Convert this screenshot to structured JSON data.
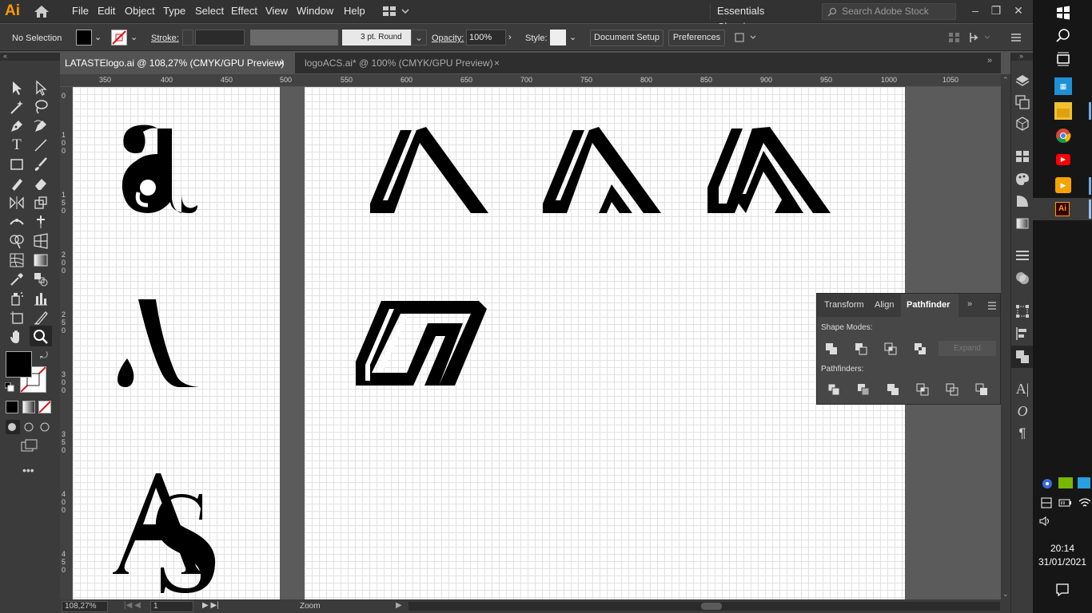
{
  "menu": {
    "app_logo": "Ai",
    "items": [
      "File",
      "Edit",
      "Object",
      "Type",
      "Select",
      "Effect",
      "View",
      "Window",
      "Help"
    ],
    "workspace": "Essentials Classic",
    "search_placeholder": "Search Adobe Stock",
    "win_min": "–",
    "win_max": "❐",
    "win_close": "✕"
  },
  "control": {
    "selection": "No Selection",
    "stroke_label": "Stroke:",
    "brush": "3 pt. Round",
    "opacity_label": "Opacity:",
    "opacity_value": "100%",
    "style_label": "Style:",
    "doc_setup": "Document Setup",
    "preferences": "Preferences"
  },
  "tabs": [
    {
      "label": "LATASTElogo.ai @ 108,27% (CMYK/GPU Preview)",
      "close": "×"
    },
    {
      "label": "logoACS.ai* @ 100% (CMYK/GPU Preview)",
      "close": "×"
    }
  ],
  "ruler": {
    "h": [
      "350",
      "400",
      "450",
      "500",
      "550",
      "600",
      "650",
      "700",
      "750",
      "800",
      "850",
      "900",
      "950",
      "1000",
      "1050"
    ],
    "v": [
      "0",
      "100",
      "150",
      "200",
      "250",
      "300",
      "350",
      "400",
      "450"
    ]
  },
  "status": {
    "zoom": "108,27%",
    "page": "1",
    "tool": "Zoom"
  },
  "pathfinder": {
    "tabs": [
      "Transform",
      "Align",
      "Pathfinder"
    ],
    "shape_modes": "Shape Modes:",
    "pathfinders": "Pathfinders:",
    "expand": "Expand"
  },
  "taskbar": {
    "time": "20:14",
    "date": "31/01/2021"
  },
  "colors": {
    "accent": "#ff9a00",
    "panel": "#3b3b3b",
    "canvas": "#535353"
  }
}
